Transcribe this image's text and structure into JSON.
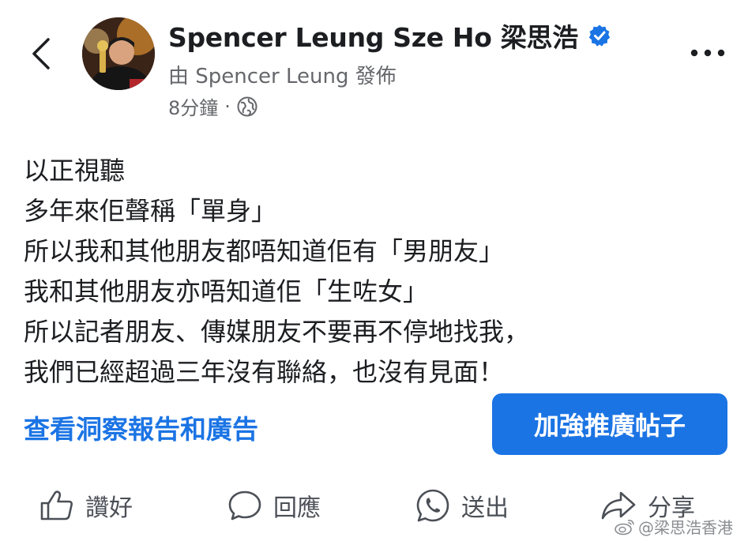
{
  "header": {
    "back_icon": "chevron-left-icon",
    "page_name": "Spencer Leung Sze Ho 梁思浩",
    "verified_icon": "verified-badge-icon",
    "posted_by": "由 Spencer Leung 發佈",
    "time": "8分鐘",
    "separator": "·",
    "audience_icon": "globe-icon",
    "more_icon": "more-horizontal-icon"
  },
  "post": {
    "lines": [
      "以正視聽",
      "多年來佢聲稱「單身」",
      "所以我和其他朋友都唔知道佢有「男朋友」",
      "我和其他朋友亦唔知道佢「生咗女」",
      "所以記者朋友、傳媒朋友不要再不停地找我，",
      "我們已經超過三年沒有聯絡，也沒有見面！"
    ]
  },
  "actions": {
    "insights_link": "查看洞察報告和廣告",
    "boost_button": "加強推廣帖子"
  },
  "bottom_bar": {
    "like": "讚好",
    "comment": "回應",
    "send": "送出",
    "share": "分享"
  },
  "watermark": {
    "text": "@梁思浩香港",
    "icon": "weibo-icon"
  },
  "colors": {
    "accent": "#1b74e4",
    "secondary_text": "#65676b",
    "primary_text": "#1c1e21"
  }
}
